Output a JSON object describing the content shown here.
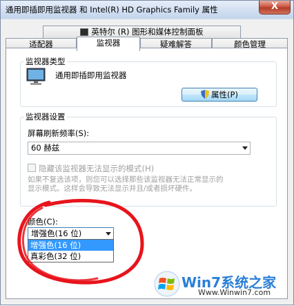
{
  "window": {
    "title": "通用即插即用监视器 和 Intel(R) HD Graphics Family 属性",
    "close_label": "X"
  },
  "tabs": {
    "top": "英特尔 (R) 图形和媒体控制面板",
    "adapter": "适配器",
    "monitor": "监视器",
    "troubleshoot": "疑难解答",
    "color_management": "颜色管理"
  },
  "monitor_type": {
    "group_label": "监视器类型",
    "name": "通用即插即用监视器",
    "properties_button": "属性(P)"
  },
  "monitor_settings": {
    "group_label": "监视器设置",
    "refresh_label": "屏幕刷新频率(S):",
    "refresh_value": "60 赫兹",
    "hide_modes_label": "隐藏该监视器无法显示的模式(H)",
    "hint_line1": "如果不复选该项，则您可以选择那些该监视器无法正常显示的",
    "hint_line2": "显示模式。这样会导致无法显示并且/或者损坏硬件。"
  },
  "colors": {
    "label": "颜色(C):",
    "selected": "增强色(16 位)",
    "options": [
      "增强色(16 位)",
      "真彩色(32 位)"
    ]
  },
  "watermark": {
    "brand": "Win7系统之家",
    "url": "Www.Winwin7.com"
  },
  "accent_colors": {
    "highlight": "#3399ff",
    "annotation": "#e8141c"
  },
  "icons": {
    "monitor": "monitor-icon",
    "shield": "shield-icon",
    "intel": "intel-tab-icon",
    "windows_logo": "windows-logo-icon"
  }
}
